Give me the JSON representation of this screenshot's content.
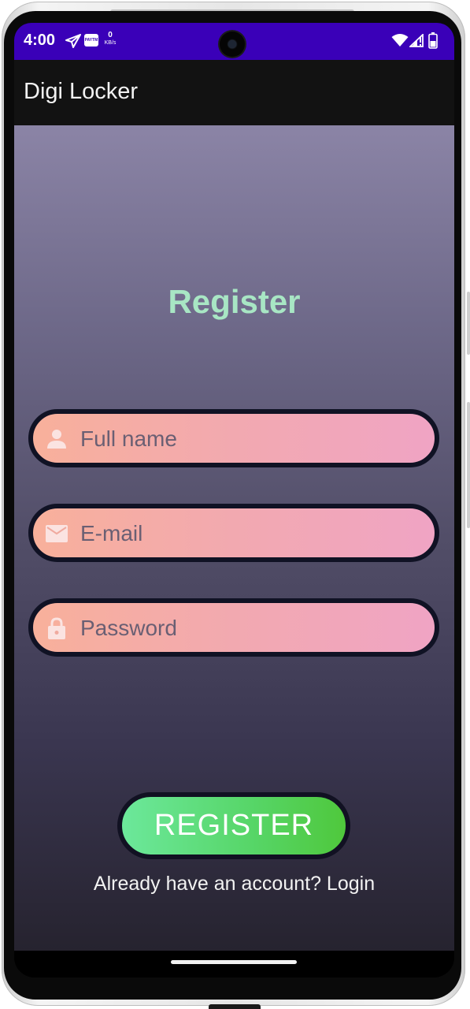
{
  "status_bar": {
    "time": "4:00",
    "paytm_label": "PAYTM",
    "speed_value": "0",
    "speed_unit": "KB/s",
    "icons": [
      "send-icon",
      "paytm-icon",
      "wifi-icon",
      "signal-icon",
      "battery-icon"
    ],
    "color": "#3a00b8"
  },
  "app_bar": {
    "title": "Digi Locker"
  },
  "form": {
    "title": "Register",
    "full_name_placeholder": "Full name",
    "email_placeholder": "E-mail",
    "password_placeholder": "Password",
    "submit_label": "REGISTER",
    "login_prompt": "Already have an account? Login"
  },
  "colors": {
    "title": "#a8e6c4",
    "field_gradient_start": "#f8b09b",
    "field_gradient_end": "#f0a4c4",
    "button_gradient_start": "#6ce89b",
    "button_gradient_end": "#4fc83c"
  }
}
